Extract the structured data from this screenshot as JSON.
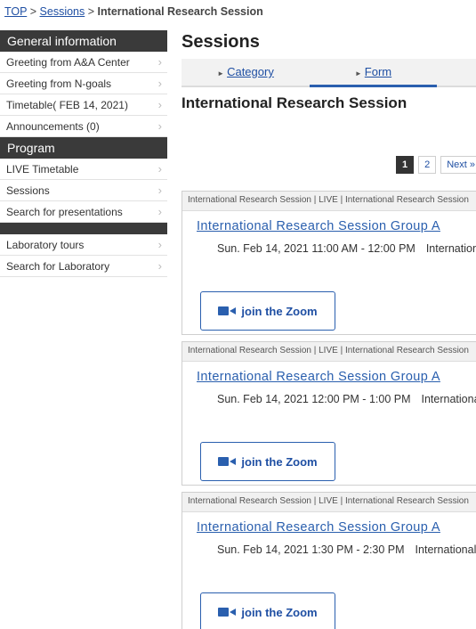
{
  "breadcrumb": {
    "top": "TOP",
    "sep1": ">",
    "sessions": "Sessions",
    "sep2": ">",
    "current": "International Research Session"
  },
  "sidebar": {
    "general_heading": "General information",
    "general_items": [
      {
        "label": "Greeting from A&A Center"
      },
      {
        "label": "Greeting from N-goals"
      },
      {
        "label": "Timetable( FEB 14, 2021)"
      },
      {
        "label": "Announcements (0)"
      }
    ],
    "program_heading": "Program",
    "program_items": [
      {
        "label": "LIVE Timetable"
      },
      {
        "label": "Sessions"
      },
      {
        "label": "Search for presentations"
      }
    ],
    "other_items": [
      {
        "label": "Laboratory tours"
      },
      {
        "label": "Search for Laboratory"
      }
    ],
    "chevron": "›"
  },
  "main": {
    "title": "Sessions",
    "tabs": [
      {
        "label": "Category",
        "marker": "►"
      },
      {
        "label": "Form",
        "marker": "►"
      }
    ],
    "subtitle": "International Research Session",
    "pager": {
      "pages": [
        "1",
        "2"
      ],
      "next": "Next »"
    },
    "cards": [
      {
        "category": "International Research Session | LIVE | International Research Session",
        "title": "International Research Session Group A",
        "time": "Sun. Feb 14, 2021 11:00 AM - 12:00 PM",
        "room": "International",
        "button": "join the Zoom"
      },
      {
        "category": "International Research Session | LIVE | International Research Session",
        "title": "International Research Session Group A",
        "time": "Sun. Feb 14, 2021 12:00 PM - 1:00 PM",
        "room": "International",
        "button": "join the Zoom"
      },
      {
        "category": "International Research Session | LIVE | International Research Session",
        "title": "International Research Session Group A",
        "time": "Sun. Feb 14, 2021 1:30 PM - 2:30 PM",
        "room": "International",
        "button": "join the Zoom"
      }
    ]
  },
  "icons": {
    "zoom": "video-camera-icon",
    "chevron": "chevron-right-icon",
    "tab_marker": "triangle-right-icon"
  },
  "colors": {
    "accent": "#2a5fae",
    "sidebar_heading": "#3a3a3a",
    "link": "#1f4fa3"
  }
}
